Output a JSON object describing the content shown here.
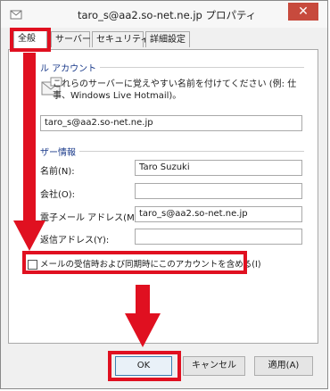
{
  "window": {
    "title": "taro_s@aa2.so-net.ne.jp プロパティ",
    "close_glyph": "✕"
  },
  "tabs": [
    {
      "label": "全般",
      "active": true
    },
    {
      "label": "サーバー",
      "active": false
    },
    {
      "label": "セキュリティ",
      "active": false
    },
    {
      "label": "詳細設定",
      "active": false
    }
  ],
  "mail_account": {
    "section_label": "ル アカウント",
    "help_text": "これらのサーバーに覚えやすい名前を付けてください (例: 仕事、Windows Live Hotmail)。",
    "account_name": "taro_s@aa2.so-net.ne.jp"
  },
  "user_info": {
    "section_label": "ザー情報",
    "name_label": "名前(N):",
    "name_value": "Taro Suzuki",
    "company_label": "会社(O):",
    "company_value": "",
    "email_label": "電子メール アドレス(M):",
    "email_value": "taro_s@aa2.so-net.ne.jp",
    "reply_label": "返信アドレス(Y):",
    "reply_value": ""
  },
  "include_checkbox": {
    "label": "メールの受信時および同期時にこのアカウントを含める(I)",
    "checked": false
  },
  "buttons": {
    "ok": "OK",
    "cancel": "キャンセル",
    "apply": "適用(A)"
  },
  "colors": {
    "highlight": "#e01020",
    "section_text": "#1a3a8a"
  }
}
